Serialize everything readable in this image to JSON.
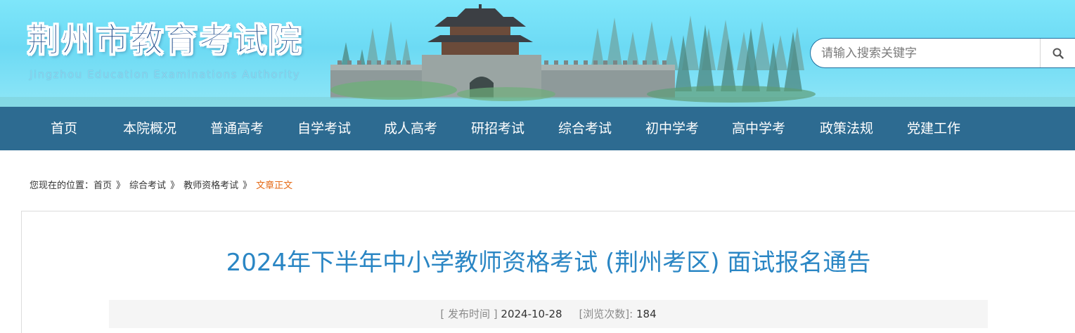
{
  "header": {
    "title": "荆州市教育考试院",
    "subtitle": "Jingzhou Education Examinations Authority",
    "search": {
      "placeholder": "请输入搜索关键字",
      "value": "",
      "button_icon": "search-icon"
    }
  },
  "nav": {
    "items": [
      {
        "label": "首页"
      },
      {
        "label": "本院概况"
      },
      {
        "label": "普通高考"
      },
      {
        "label": "自学考试"
      },
      {
        "label": "成人高考"
      },
      {
        "label": "研招考试"
      },
      {
        "label": "综合考试"
      },
      {
        "label": "初中学考"
      },
      {
        "label": "高中学考"
      },
      {
        "label": "政策法规"
      },
      {
        "label": "党建工作"
      }
    ]
  },
  "breadcrumb": {
    "prefix": "您现在的位置：",
    "items": [
      "首页",
      "综合考试",
      "教师资格考试"
    ],
    "separator": "》",
    "current": "文章正文"
  },
  "article": {
    "title": "2024年下半年中小学教师资格考试 (荆州考区) 面试报名通告",
    "publish_label": "[ 发布时间 ]",
    "publish_date": "2024-10-28",
    "views_label": "[浏览次数]:",
    "views": "184"
  },
  "colors": {
    "nav_bg": "#2d6b91",
    "title_blue": "#2a86c4",
    "breadcrumb_current": "#e56a16",
    "header_sky": "#7ee6fa"
  }
}
